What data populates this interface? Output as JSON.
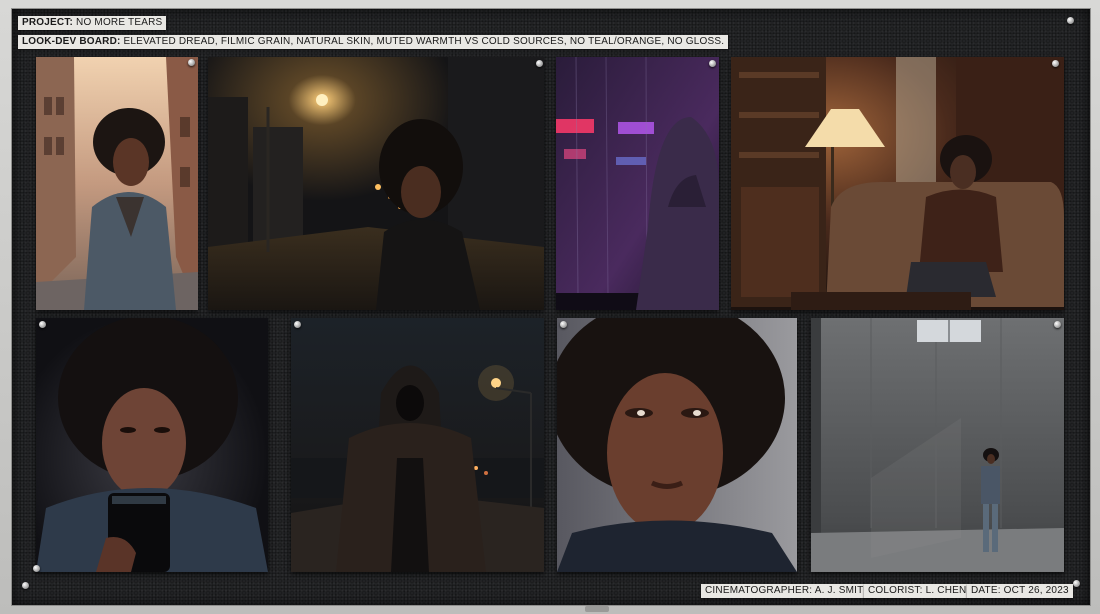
{
  "project": {
    "label": "PROJECT:",
    "value": "NO MORE TEARS"
  },
  "lookdev": {
    "label": "LOOK-DEV BOARD:",
    "value": "ELEVATED DREAD, FILMIC GRAIN, NATURAL SKIN, MUTED WARMTH VS COLD SOURCES, NO TEAL/ORANGE, NO GLOSS."
  },
  "credits": {
    "cinematographer": "CINEMATOGRAPHER: A. J. SMITH",
    "colorist": "COLORIST: L. CHEN",
    "date": "DATE: OCT 26, 2023"
  },
  "photos": [
    {
      "subject": "woman in denim jacket on city street at golden hour"
    },
    {
      "subject": "woman on wet night street under warm streetlights"
    },
    {
      "subject": "hooded figure behind rainy window with neon signs"
    },
    {
      "subject": "woman seated on sofa in lamp-lit living room"
    },
    {
      "subject": "woman lit by phone screen in the dark"
    },
    {
      "subject": "hooded figure standing on dark road at night"
    },
    {
      "subject": "close-up of worried woman's face"
    },
    {
      "subject": "small figure standing in empty concrete room"
    }
  ],
  "colors": {
    "board": "#222325",
    "label_bg": "#e9e8e4",
    "frame": "#c9c9c7"
  }
}
